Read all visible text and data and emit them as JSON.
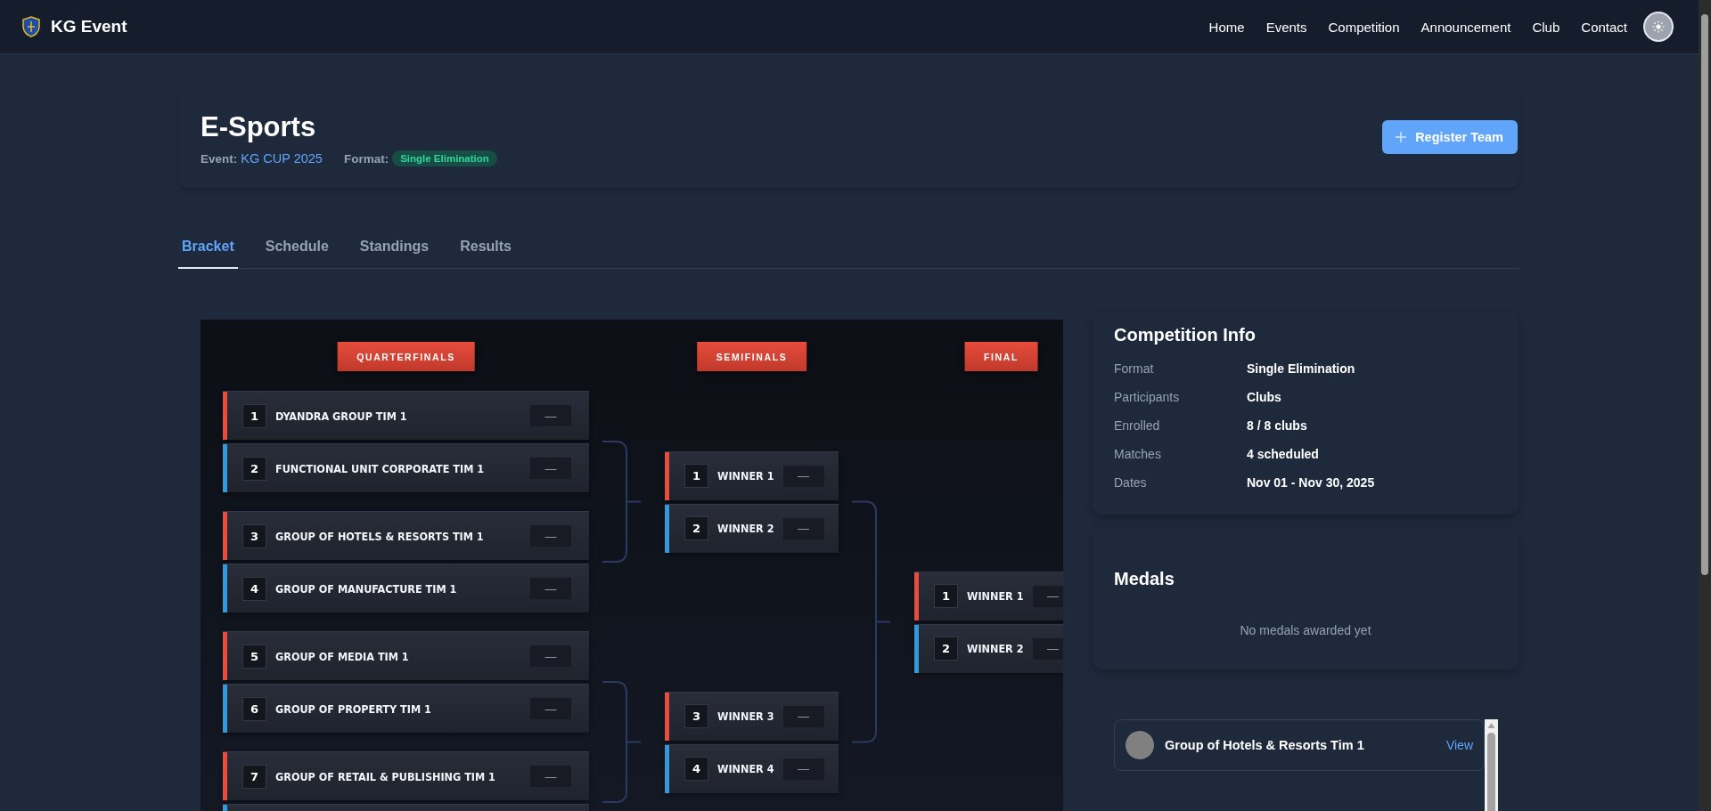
{
  "nav": {
    "brand": "KG Event",
    "links": [
      {
        "label": "Home"
      },
      {
        "label": "Events"
      },
      {
        "label": "Competition"
      },
      {
        "label": "Announcement"
      },
      {
        "label": "Club"
      },
      {
        "label": "Contact"
      }
    ]
  },
  "header": {
    "title": "E-Sports",
    "event_label": "Event:",
    "event_name": "KG CUP 2025",
    "format_label": "Format:",
    "format_badge": "Single Elimination",
    "register_button": "Register Team"
  },
  "tabs": [
    {
      "label": "Bracket",
      "selected": true
    },
    {
      "label": "Schedule",
      "selected": false
    },
    {
      "label": "Standings",
      "selected": false
    },
    {
      "label": "Results",
      "selected": false
    }
  ],
  "bracket": {
    "rounds": [
      {
        "title": "QUARTERFINALS",
        "matches": [
          {
            "slots": [
              {
                "seed": "1",
                "team": "DYANDRA GROUP TIM 1",
                "score": "—",
                "color": "#e74c3c"
              },
              {
                "seed": "2",
                "team": "FUNCTIONAL UNIT CORPORATE TIM 1",
                "score": "—",
                "color": "#3498db"
              }
            ]
          },
          {
            "slots": [
              {
                "seed": "3",
                "team": "GROUP OF HOTELS & RESORTS TIM 1",
                "score": "—",
                "color": "#e74c3c"
              },
              {
                "seed": "4",
                "team": "GROUP OF MANUFACTURE TIM 1",
                "score": "—",
                "color": "#3498db"
              }
            ]
          },
          {
            "slots": [
              {
                "seed": "5",
                "team": "GROUP OF MEDIA TIM 1",
                "score": "—",
                "color": "#e74c3c"
              },
              {
                "seed": "6",
                "team": "GROUP OF PROPERTY TIM 1",
                "score": "—",
                "color": "#3498db"
              }
            ]
          },
          {
            "slots": [
              {
                "seed": "7",
                "team": "GROUP OF RETAIL & PUBLISHING TIM 1",
                "score": "—",
                "color": "#e74c3c"
              },
              {
                "color": "#3498db"
              }
            ]
          }
        ]
      },
      {
        "title": "SEMIFINALS",
        "matches": [
          {
            "slots": [
              {
                "seed": "1",
                "team": "WINNER 1",
                "score": "—",
                "color": "#e74c3c"
              },
              {
                "seed": "2",
                "team": "WINNER 2",
                "score": "—",
                "color": "#3498db"
              }
            ]
          },
          {
            "slots": [
              {
                "seed": "3",
                "team": "WINNER 3",
                "score": "—",
                "color": "#e74c3c"
              },
              {
                "seed": "4",
                "team": "WINNER 4",
                "score": "—",
                "color": "#3498db"
              }
            ]
          }
        ]
      },
      {
        "title": "FINAL",
        "matches": [
          {
            "slots": [
              {
                "seed": "1",
                "team": "WINNER 1",
                "score": "—",
                "color": "#e74c3c"
              },
              {
                "seed": "2",
                "team": "WINNER 2",
                "score": "—",
                "color": "#3498db"
              }
            ]
          }
        ]
      }
    ]
  },
  "competition_info": {
    "title": "Competition Info",
    "rows": [
      {
        "label": "Format",
        "value": "Single Elimination"
      },
      {
        "label": "Participants",
        "value": "Clubs"
      },
      {
        "label": "Enrolled",
        "value": "8 / 8 clubs"
      },
      {
        "label": "Matches",
        "value": "4 scheduled"
      },
      {
        "label": "Dates",
        "value": "Nov 01 - Nov 30, 2025"
      }
    ]
  },
  "medals": {
    "title": "Medals",
    "empty_text": "No medals awarded yet"
  },
  "clubs": [
    {
      "name": "Group of Hotels & Resorts Tim 1",
      "action": "View"
    }
  ]
}
